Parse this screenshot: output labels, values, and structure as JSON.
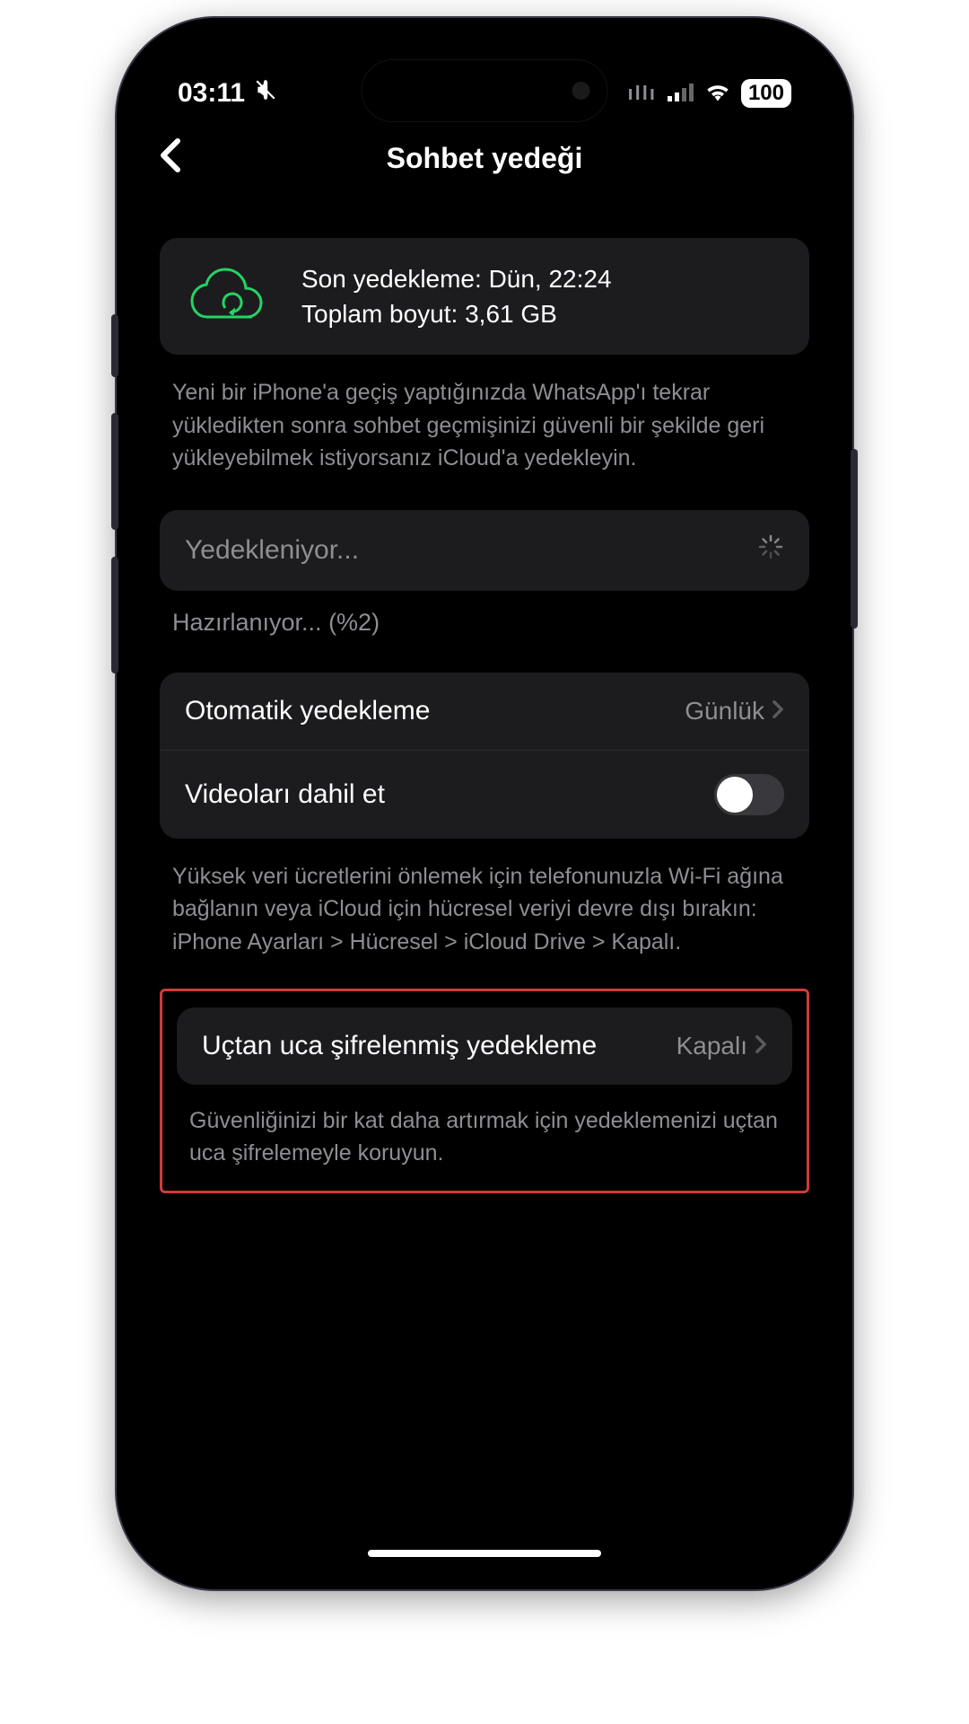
{
  "status": {
    "time": "03:11",
    "silent": true,
    "battery": "100"
  },
  "nav": {
    "title": "Sohbet yedeği"
  },
  "summary": {
    "last_backup_label": "Son yedekleme: Dün, 22:24",
    "size_label": "Toplam boyut: 3,61 GB"
  },
  "info": {
    "description": "Yeni bir iPhone'a geçiş yaptığınızda WhatsApp'ı tekrar yükledikten sonra sohbet geçmişinizi güvenli bir şekilde geri yükleyebilmek istiyorsanız iCloud'a yedekleyin."
  },
  "backup_progress": {
    "title": "Yedekleniyor...",
    "status": "Hazırlanıyor... (%2)"
  },
  "settings": {
    "auto_backup_label": "Otomatik yedekleme",
    "auto_backup_value": "Günlük",
    "include_videos_label": "Videoları dahil et",
    "include_videos_on": false,
    "data_warning": "Yüksek veri ücretlerini önlemek için telefonunuzla Wi-Fi ağına bağlanın veya iCloud için hücresel veriyi devre dışı bırakın: iPhone Ayarları > Hücresel > iCloud Drive > Kapalı."
  },
  "e2e": {
    "label": "Uçtan uca şifrelenmiş yedekleme",
    "value": "Kapalı",
    "description": "Güvenliğinizi bir kat daha artırmak için yedeklemenizi uçtan uca şifrelemeyle koruyun."
  }
}
